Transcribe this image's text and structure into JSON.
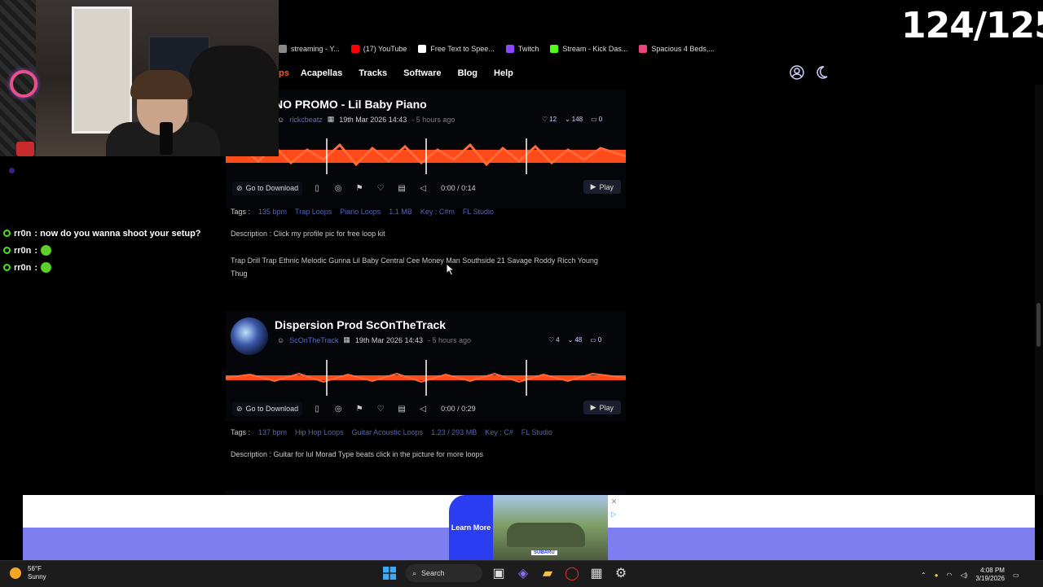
{
  "counter": "124/125",
  "bookmarks": [
    {
      "label": "streaming - Y...",
      "icon": "page-icon",
      "color": "#888888"
    },
    {
      "label": "(17) YouTube",
      "icon": "youtube-icon",
      "color": "#ff0000"
    },
    {
      "label": "Free Text to Spee...",
      "icon": "text-icon",
      "color": "#ffffff"
    },
    {
      "label": "Twitch",
      "icon": "twitch-icon",
      "color": "#9146ff"
    },
    {
      "label": "Stream - Kick Das...",
      "icon": "kick-icon",
      "color": "#53fc18"
    },
    {
      "label": "Spacious 4 Beds,...",
      "icon": "house-icon",
      "color": "#e8457a"
    }
  ],
  "nav": {
    "cut_label": "ps",
    "items": [
      "Acapellas",
      "Tracks",
      "Software",
      "Blog",
      "Help"
    ]
  },
  "tracks": [
    {
      "title": "NO PROMO - Lil Baby Piano",
      "user": "rickcbeatz",
      "date": "19th Mar 2026 14:43",
      "ago": "- 5 hours ago",
      "likes": "12",
      "downloads": "148",
      "comments": "0",
      "download_label": "Go to Download",
      "time": "0:00 / 0:14",
      "play_label": "Play",
      "tags_label": "Tags :",
      "tags": [
        "135 bpm",
        "Trap Loops",
        "Piano Loops",
        "1.1 MB",
        "Key : C#m",
        "FL Studio"
      ],
      "description_label": "Description :",
      "description": "Click my profile pic for free loop kit",
      "extra": "Trap Drill Trap Ethnic Melodic Gunna Lil Baby Central Cee Money Man Southside 21 Savage Roddy Ricch Young Thug"
    },
    {
      "title": "Dispersion Prod ScOnTheTrack",
      "user": "ScOnTheTrack",
      "date": "19th Mar 2026 14:43",
      "ago": "- 5 hours ago",
      "likes": "4",
      "downloads": "48",
      "comments": "0",
      "download_label": "Go to Download",
      "time": "0:00 / 0:29",
      "play_label": "Play",
      "tags_label": "Tags :",
      "tags": [
        "137 bpm",
        "Hip Hop Loops",
        "Guitar Acoustic Loops",
        "1.23 / 293 MB",
        "Key : C#",
        "FL Studio"
      ],
      "description_label": "Description :",
      "description": "Guitar for lul Morad Type beats click in the picture for more loops"
    }
  ],
  "chat": [
    {
      "user": "rr0n",
      "text": ": now do you wanna shoot your setup?",
      "emote": false
    },
    {
      "user": "rr0n",
      "text": ":",
      "emote": true
    },
    {
      "user": "rr0n",
      "text": ":",
      "emote": true
    }
  ],
  "ad": {
    "learn_more": "Learn More",
    "brand": "SUBARU"
  },
  "taskbar": {
    "temp": "56°F",
    "condition": "Sunny",
    "search_label": "Search",
    "time": "4:08 PM",
    "date": "3/19/2026"
  }
}
